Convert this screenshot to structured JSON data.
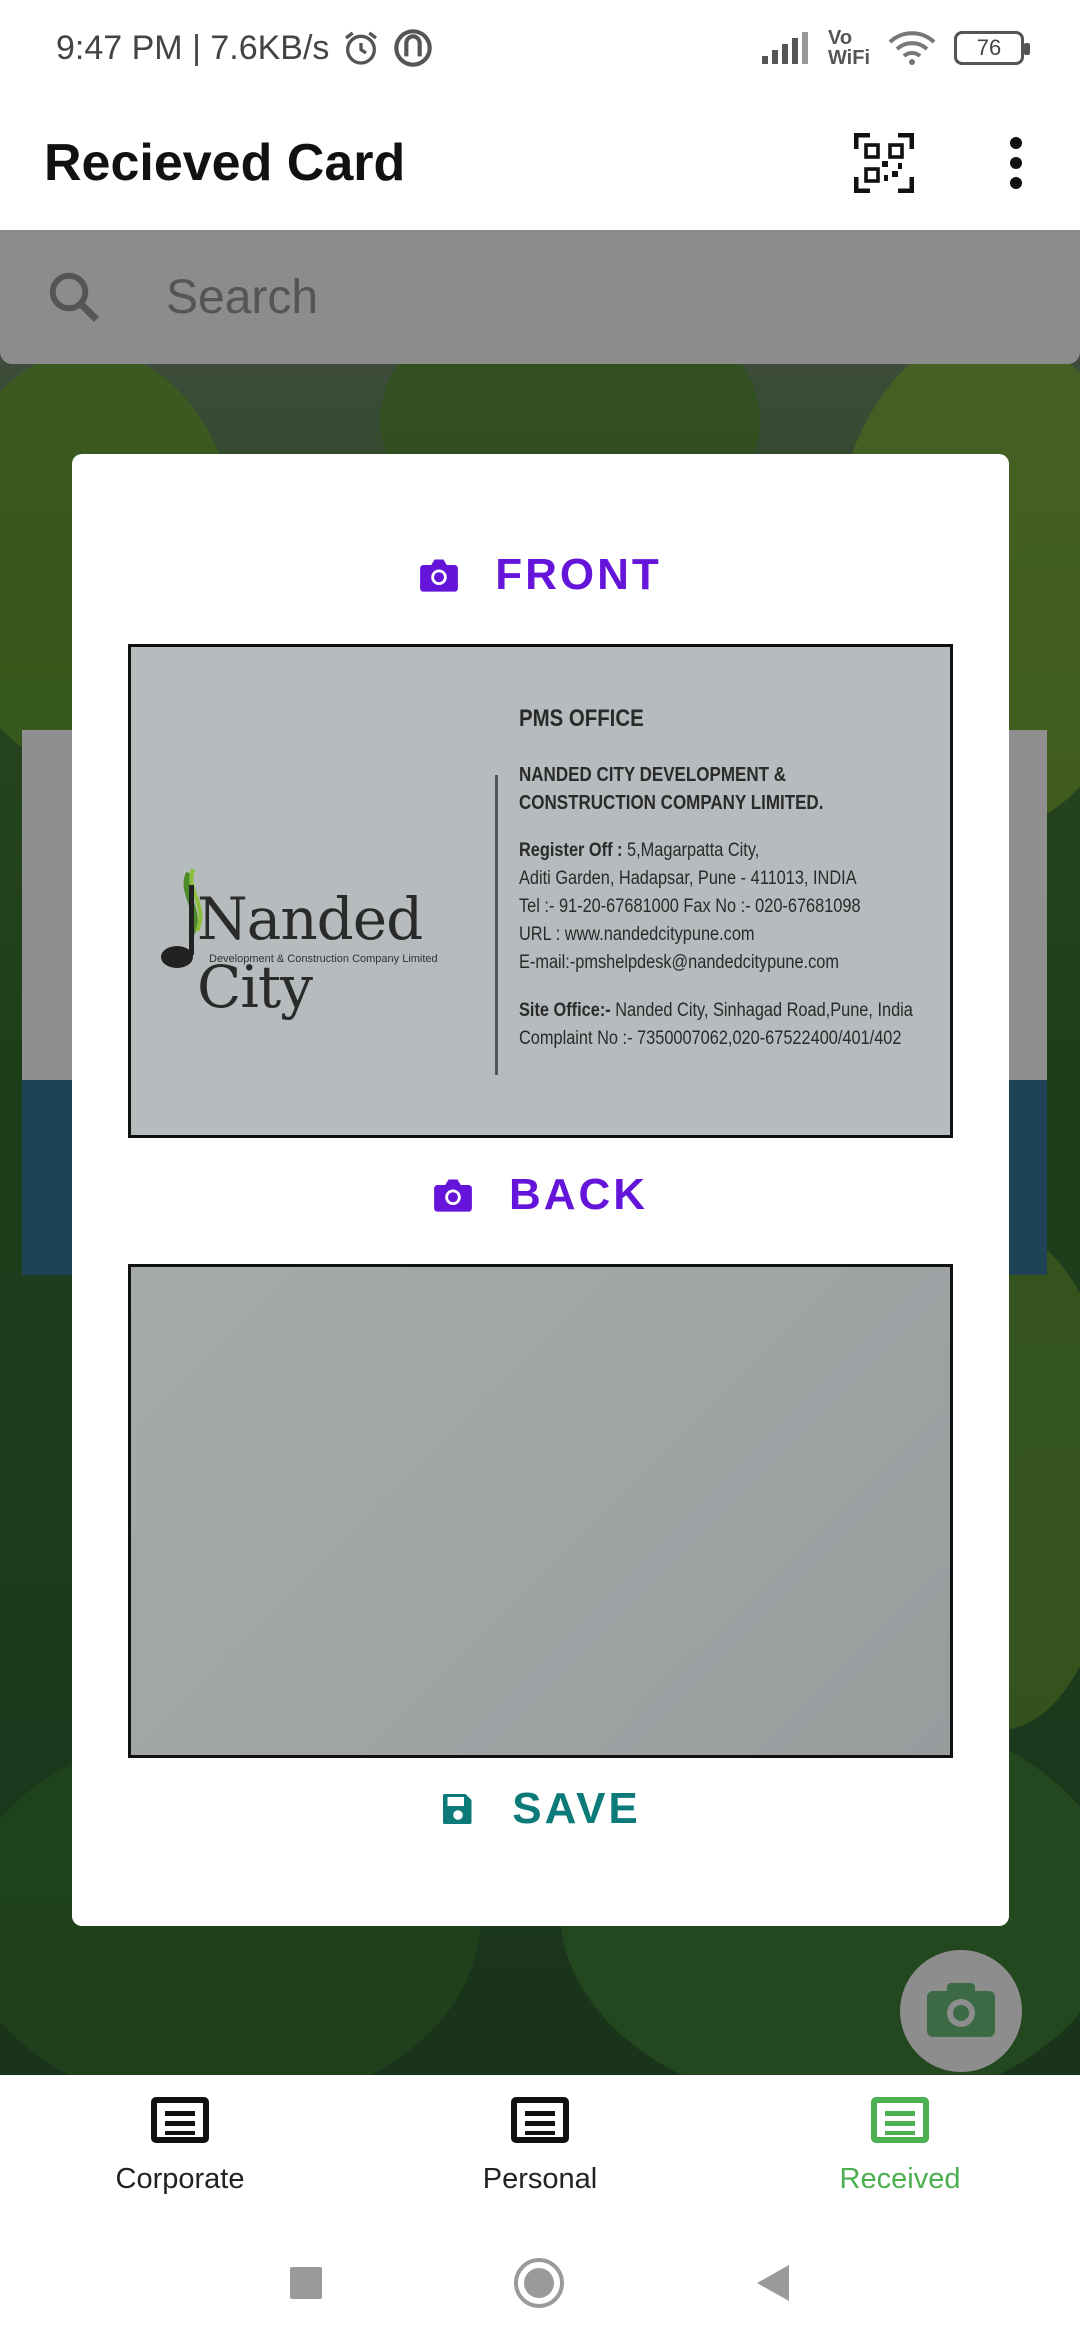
{
  "status_bar": {
    "time_speed": "9:47 PM | 7.6KB/s",
    "vo_label": "Vo",
    "wifi_label": "WiFi",
    "battery": "76"
  },
  "app_bar": {
    "title": "Recieved Card",
    "qr_icon": "qr-code-scan-icon",
    "more_icon": "more-vert-icon"
  },
  "search": {
    "placeholder": "Search"
  },
  "dialog": {
    "front_label": "FRONT",
    "back_label": "BACK",
    "save_label": "SAVE",
    "camera_icon": "camera-icon",
    "save_icon": "floppy-disk-icon",
    "accent_color": "#6515d9",
    "save_color": "#0c7a78"
  },
  "card_front": {
    "logo_text": "Nanded City",
    "logo_sub": "Development & Construction Company Limited",
    "office": "PMS OFFICE",
    "company_line1": "NANDED CITY DEVELOPMENT &",
    "company_line2": "CONSTRUCTION COMPANY LIMITED.",
    "register_label": "Register Off :",
    "register_value": " 5,Magarpatta City,",
    "address_line": "Aditi Garden, Hadapsar, Pune - 411013, INDIA",
    "tel_line": "Tel :- 91-20-67681000  Fax No :- 020-67681098",
    "url_line": "URL : www.nandedcitypune.com",
    "email_line": "E-mail:-pmshelpdesk@nandedcitypune.com",
    "site_label": "Site Office:-",
    "site_value": " Nanded City, Sinhagad Road,Pune, India",
    "complaint_line": "Complaint No :- 7350007062,020-67522400/401/402"
  },
  "bottom_nav": {
    "items": [
      {
        "label": "Corporate",
        "icon": "card-list-icon"
      },
      {
        "label": "Personal",
        "icon": "card-list-icon"
      },
      {
        "label": "Received",
        "icon": "card-list-icon"
      }
    ],
    "active_color": "#4caf50"
  },
  "system_nav": {
    "recents_icon": "recents-square-icon",
    "home_icon": "home-circle-icon",
    "back_icon": "back-triangle-icon"
  }
}
